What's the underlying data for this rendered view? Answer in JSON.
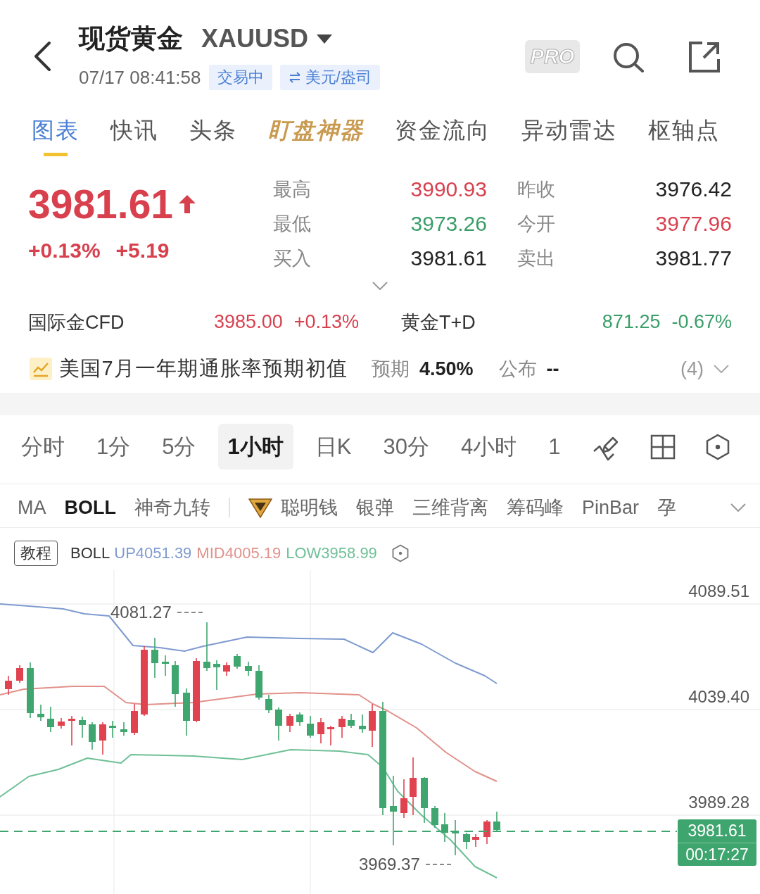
{
  "header": {
    "title": "现货黄金",
    "symbol": "XAUUSD",
    "timestamp": "07/17 08:41:58",
    "badges": [
      {
        "kind": "status",
        "label": "交易中"
      },
      {
        "kind": "conversion",
        "label": "美元/盎司"
      }
    ],
    "pro_label": "PRO"
  },
  "tabs": [
    {
      "label": "图表",
      "selected": true,
      "kind": "plain"
    },
    {
      "label": "快讯",
      "selected": false,
      "kind": "plain"
    },
    {
      "label": "头条",
      "selected": false,
      "kind": "plain"
    },
    {
      "label": "盯盘神器",
      "selected": false,
      "kind": "featured"
    },
    {
      "label": "资金流向",
      "selected": false,
      "kind": "plain"
    },
    {
      "label": "异动雷达",
      "selected": false,
      "kind": "plain"
    },
    {
      "label": "枢轴点",
      "selected": false,
      "kind": "plain"
    }
  ],
  "quote": {
    "price": "3981.61",
    "rising": true,
    "change_percent": "+0.13%",
    "change": "+5.19",
    "stats": [
      {
        "label": "最高",
        "value": "3990.93",
        "color": "#d8404e"
      },
      {
        "label": "昨收",
        "value": "3976.42",
        "color": "#222222"
      },
      {
        "label": "最低",
        "value": "3973.26",
        "color": "#3a9e69"
      },
      {
        "label": "今开",
        "value": "3977.96",
        "color": "#d8404e"
      },
      {
        "label": "买入",
        "value": "3981.61",
        "color": "#222222"
      },
      {
        "label": "卖出",
        "value": "3981.77",
        "color": "#222222"
      }
    ]
  },
  "related": [
    {
      "name": "国际金CFD",
      "price": "3985.00",
      "change": "+0.13%",
      "color": "#d8404e"
    },
    {
      "name": "黄金T+D",
      "price": "871.25",
      "change": "-0.67%",
      "color": "#3a9e69"
    }
  ],
  "event": {
    "title": "美国7月一年期通胀率预期初值",
    "forecast_label": "预期",
    "forecast": "4.50%",
    "actual_label": "公布",
    "actual": "--",
    "count": "(4)"
  },
  "intervals": [
    {
      "label": "分时",
      "selected": false
    },
    {
      "label": "1分",
      "selected": false
    },
    {
      "label": "5分",
      "selected": false
    },
    {
      "label": "1小时",
      "selected": true
    },
    {
      "label": "日K",
      "selected": false
    },
    {
      "label": "30分",
      "selected": false
    },
    {
      "label": "4小时",
      "selected": false
    },
    {
      "label": "1",
      "selected": false
    }
  ],
  "indicators": [
    {
      "label": "MA",
      "selected": false,
      "kind": "standard"
    },
    {
      "label": "BOLL",
      "selected": true,
      "kind": "standard"
    },
    {
      "label": "神奇九转",
      "selected": false,
      "kind": "standard"
    },
    {
      "label": "聪明钱",
      "selected": false,
      "kind": "premium"
    },
    {
      "label": "银弹",
      "selected": false,
      "kind": "standard"
    },
    {
      "label": "三维背离",
      "selected": false,
      "kind": "standard"
    },
    {
      "label": "筹码峰",
      "selected": false,
      "kind": "standard"
    },
    {
      "label": "PinBar",
      "selected": false,
      "kind": "standard"
    },
    {
      "label": "孕",
      "selected": false,
      "kind": "standard"
    }
  ],
  "chart": {
    "tutorial_button": "教程",
    "indicator": "BOLL",
    "legend": [
      {
        "label": "UP4051.39",
        "color": "#7e9ad0"
      },
      {
        "label": "MID4005.19",
        "color": "#e2908a"
      },
      {
        "label": "LOW3958.99",
        "color": "#6fc097"
      }
    ],
    "axis_labels": [
      "4089.51",
      "4039.40",
      "3989.28"
    ],
    "high_marker": "4081.27",
    "low_marker": "3969.37",
    "last_price": "3981.61",
    "countdown": "00:17:27"
  }
}
